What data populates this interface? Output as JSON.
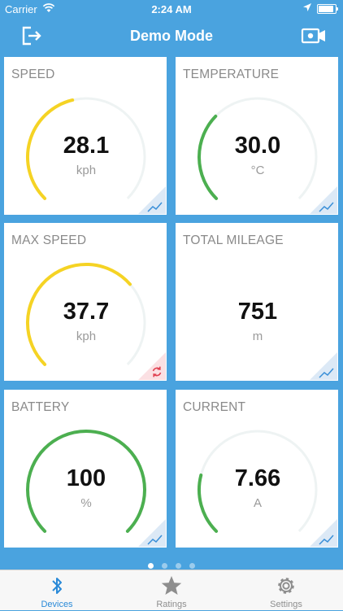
{
  "status_bar": {
    "carrier": "Carrier",
    "time": "2:24 AM"
  },
  "nav": {
    "title": "Demo Mode",
    "left_icon": "logout-icon",
    "right_icon": "video-camera-icon"
  },
  "cards": [
    {
      "label": "SPEED",
      "value": "28.1",
      "unit": "kph",
      "gauge_fraction": 0.45,
      "gauge_color": "#f5d324",
      "corner": "chart-icon",
      "corner_color": "#dce9f6"
    },
    {
      "label": "TEMPERATURE",
      "value": "30.0",
      "unit": "°C",
      "gauge_fraction": 0.33,
      "gauge_color": "#4caf50",
      "corner": "chart-icon",
      "corner_color": "#dce9f6"
    },
    {
      "label": "MAX SPEED",
      "value": "37.7",
      "unit": "kph",
      "gauge_fraction": 0.68,
      "gauge_color": "#f5d324",
      "corner": "refresh-icon",
      "corner_color": "#fbe0e3"
    },
    {
      "label": "TOTAL MILEAGE",
      "value": "751",
      "unit": "m",
      "gauge_fraction": 0,
      "gauge_color": "#4caf50",
      "corner": "chart-icon",
      "corner_color": "#dce9f6",
      "gauge_hidden": true
    },
    {
      "label": "BATTERY",
      "value": "100",
      "unit": "%",
      "gauge_fraction": 1.0,
      "gauge_color": "#4caf50",
      "corner": "chart-icon",
      "corner_color": "#dce9f6"
    },
    {
      "label": "CURRENT",
      "value": "7.66",
      "unit": "A",
      "gauge_fraction": 0.22,
      "gauge_color": "#4caf50",
      "corner": "chart-icon",
      "corner_color": "#dce9f6"
    }
  ],
  "pager": {
    "total": 4,
    "active": 1
  },
  "tabs": [
    {
      "label": "Devices",
      "icon": "bluetooth-icon",
      "active": true
    },
    {
      "label": "Ratings",
      "icon": "star-icon",
      "active": false
    },
    {
      "label": "Settings",
      "icon": "gear-icon",
      "active": false
    }
  ],
  "colors": {
    "background": "#4aa3df",
    "track": "#eef3f3",
    "accent": "#2a8ad8"
  }
}
